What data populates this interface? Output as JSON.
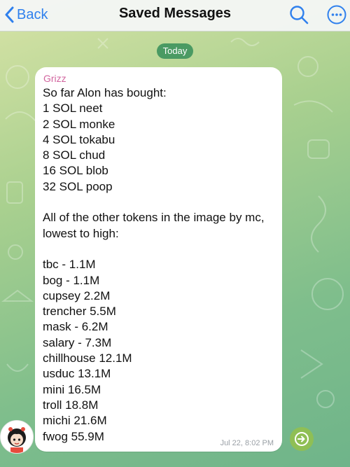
{
  "header": {
    "back_label": "Back",
    "title": "Saved Messages"
  },
  "chat": {
    "date_label": "Today"
  },
  "message": {
    "sender": "Grizz",
    "lines": [
      "So far Alon has bought:",
      "1 SOL neet",
      "2 SOL monke",
      "4 SOL tokabu",
      "8 SOL chud",
      "16 SOL blob",
      "32 SOL poop",
      "",
      "All of the other tokens in the image by mc, lowest to high:",
      "",
      "tbc - 1.1M",
      "bog - 1.1M",
      "cupsey 2.2M",
      "trencher 5.5M",
      "mask - 6.2M",
      "salary - 7.3M",
      "chillhouse 12.1M",
      "usduc 13.1M",
      "mini 16.5M",
      "troll 18.8M",
      "michi 21.6M",
      "fwog 55.9M"
    ],
    "timestamp": "Jul 22, 8:02 PM"
  },
  "colors": {
    "accent": "#2f80ed",
    "sender_name": "#d2659f",
    "date_pill": "#4a9a63",
    "share_button": "#8fbf55"
  },
  "icons": {
    "back": "chevron-left-icon",
    "search": "search-icon",
    "more": "more-horizontal-icon",
    "share": "share-arrow-icon"
  }
}
